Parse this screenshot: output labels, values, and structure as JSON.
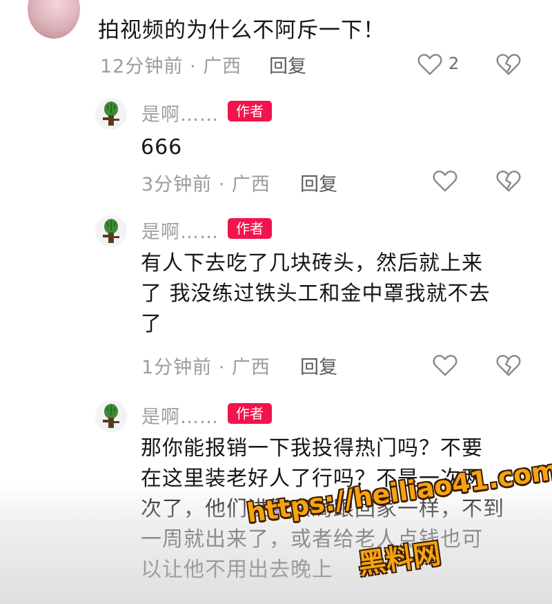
{
  "comment": {
    "text": "拍视频的为什么不阿斥一下！",
    "meta": "12分钟前 · 广西",
    "reply_label": "回复",
    "like_count": "2"
  },
  "replies": [
    {
      "username": "是啊……",
      "badge": "作者",
      "text_lines": [
        "666"
      ],
      "meta": "3分钟前 · 广西",
      "reply_label": "回复"
    },
    {
      "username": "是啊……",
      "badge": "作者",
      "text_lines": [
        "有人下去吃了几块砖头，然后就上来",
        "了 我没练过铁头工和金中罩我就不去",
        "了"
      ],
      "meta": "1分钟前 · 广西",
      "reply_label": "回复"
    },
    {
      "username": "是啊……",
      "badge": "作者",
      "text_lines": [
        "那你能报销一下我投得热门吗？不要",
        "在这里装老好人了行吗？不是一次两",
        "次了，他们进警察局跟回家一样，不到",
        "一周就出来了，或者给老人点钱也可",
        "以让他不用出去晚上"
      ]
    }
  ],
  "watermark": {
    "url": "https://heiliao41.com",
    "name": "黑料网"
  },
  "colors": {
    "badge": "#f2144c",
    "muted_text": "#9c9c9c",
    "watermark": "#f5a313"
  },
  "icons": {
    "like": "heart-outline-icon",
    "dislike": "broken-heart-icon"
  }
}
